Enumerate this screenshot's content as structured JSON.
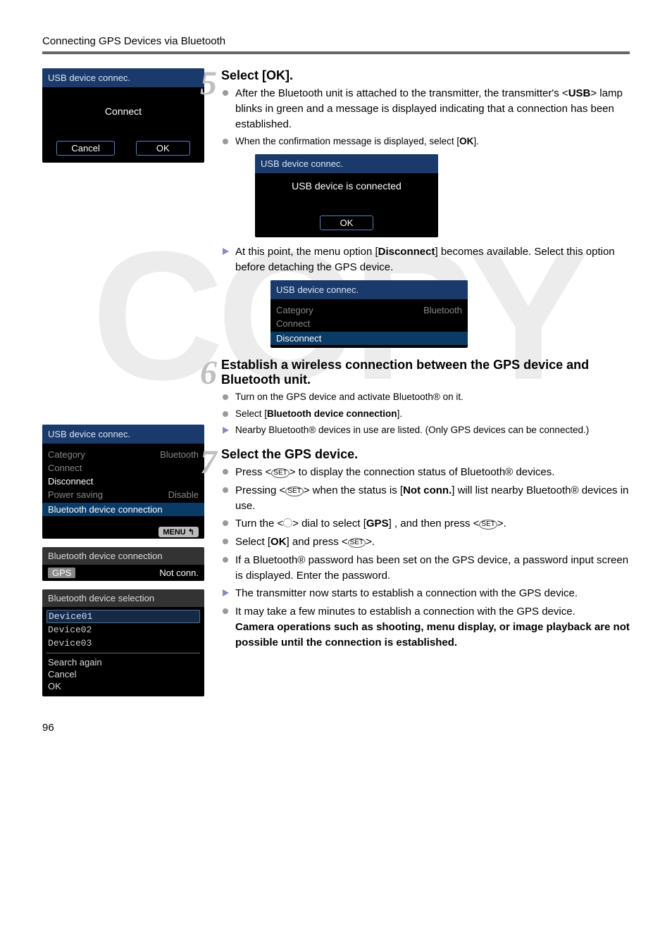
{
  "header": {
    "title": "Connecting GPS Devices via Bluetooth"
  },
  "page_number": "96",
  "watermark": "COPY",
  "left": {
    "screen1": {
      "title": "USB device connec.",
      "center": "Connect",
      "cancel": "Cancel",
      "ok": "OK"
    },
    "screen2": {
      "title": "USB device connec.",
      "rows": [
        {
          "label": "Category",
          "value": "Bluetooth",
          "dim": true
        },
        {
          "label": "Connect",
          "value": "",
          "dim": true
        },
        {
          "label": "Disconnect",
          "value": "",
          "dim": false
        },
        {
          "label": "Power saving",
          "value": "Disable",
          "dim": true
        }
      ],
      "highlight": "Bluetooth device connection",
      "footer_badge": "MENU ↰"
    },
    "screen3": {
      "title": "Bluetooth device connection",
      "left_label": "GPS",
      "right_label": "Not conn."
    },
    "screen4": {
      "title": "Bluetooth device selection",
      "devices": [
        "Device01",
        "Device02",
        "Device03"
      ],
      "actions": [
        "Search again",
        "Cancel",
        "OK"
      ]
    }
  },
  "steps": {
    "s5": {
      "num": "5",
      "heading": "Select [OK].",
      "b1_pre": "After the Bluetooth unit is attached to the transmitter, the transmitter's <",
      "b1_usb": "USB",
      "b1_post": "> lamp blinks in green and a message is displayed indicating that a connection has been established.",
      "b2_pre": "When the confirmation message is displayed, select [",
      "b2_ok": "OK",
      "b2_post": "].",
      "inset1": {
        "title": "USB device connec.",
        "msg": "USB device is connected",
        "ok": "OK"
      },
      "b3_pre": "At this point, the menu option [",
      "b3_disc": "Disconnect",
      "b3_post": "] becomes available. Select this option before detaching the GPS device.",
      "inset2": {
        "title": "USB device connec.",
        "rows": [
          {
            "label": "Category",
            "value": "Bluetooth",
            "dim": true
          },
          {
            "label": "Connect",
            "value": "",
            "dim": true
          }
        ],
        "highlight": "Disconnect"
      }
    },
    "s6": {
      "num": "6",
      "heading": "Establish a wireless connection between the GPS device and Bluetooth unit.",
      "b1": "Turn on the GPS device and activate Bluetooth® on it.",
      "b2_pre": "Select [",
      "b2_bold": "Bluetooth device connection",
      "b2_post": "].",
      "b3": "Nearby Bluetooth® devices in use are listed. (Only GPS devices can be connected.)"
    },
    "s7": {
      "num": "7",
      "heading": "Select the GPS device.",
      "b1_pre": "Press <",
      "b1_post": "> to display the connection status of Bluetooth® devices.",
      "b2_pre": "Pressing <",
      "b2_mid": "> when the status is [",
      "b2_bold": "Not conn.",
      "b2_post": "] will list nearby Bluetooth® devices in use.",
      "b3_pre": "Turn the <",
      "b3_mid": "> dial to select [",
      "b3_bold": "GPS",
      "b3_mid2": "] , and then press <",
      "b3_post": ">.",
      "b4_pre": "Select [",
      "b4_bold": "OK",
      "b4_mid": "] and press <",
      "b4_post": ">.",
      "b5": "If a Bluetooth® password has been set on the GPS device, a password input screen is displayed. Enter the password.",
      "b6": "The transmitter now starts to establish a connection with the GPS device.",
      "b7_plain": "It may take a few minutes to establish a connection with the GPS device.",
      "b7_bold": "Camera operations such as shooting, menu display, or image playback are not possible until the connection is established."
    }
  }
}
